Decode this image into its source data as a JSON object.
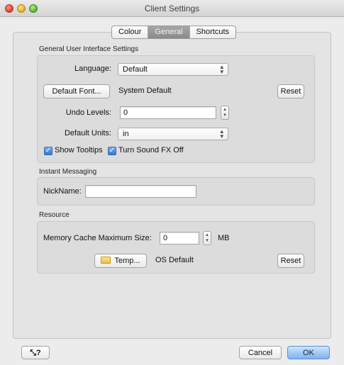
{
  "window": {
    "title": "Client Settings"
  },
  "tabs": [
    {
      "label": "Colour",
      "active": false
    },
    {
      "label": "General",
      "active": true
    },
    {
      "label": "Shortcuts",
      "active": false
    }
  ],
  "general_ui": {
    "section_label": "General User Interface Settings",
    "language_label": "Language:",
    "language_value": "Default",
    "default_font_button": "Default Font...",
    "font_value": "System Default",
    "reset_label": "Reset",
    "undo_levels_label": "Undo Levels:",
    "undo_levels_value": "0",
    "default_units_label": "Default Units:",
    "default_units_value": "in",
    "show_tooltips_label": "Show Tooltips",
    "show_tooltips_checked": true,
    "sound_fx_label": "Turn Sound FX Off",
    "sound_fx_checked": true
  },
  "instant_messaging": {
    "section_label": "Instant Messaging",
    "nickname_label": "NickName:",
    "nickname_value": ""
  },
  "resource": {
    "section_label": "Resource",
    "memory_cache_label": "Memory Cache Maximum Size:",
    "memory_cache_value": "0",
    "memory_unit": "MB",
    "temp_button": "Temp...",
    "temp_value": "OS Default",
    "reset_label": "Reset"
  },
  "footer": {
    "help_glyph": "?",
    "cancel_label": "Cancel",
    "ok_label": "OK"
  },
  "colors": {
    "accent_default_button": "#7fb2ee",
    "active_tab": "#8a8a8a",
    "checkbox": "#3376d6"
  },
  "icons": [
    "close-icon",
    "minimize-icon",
    "zoom-icon",
    "popup-arrows-icon",
    "stepper-arrows-icon",
    "checkmark-icon",
    "folder-icon",
    "help-wand-icon"
  ]
}
